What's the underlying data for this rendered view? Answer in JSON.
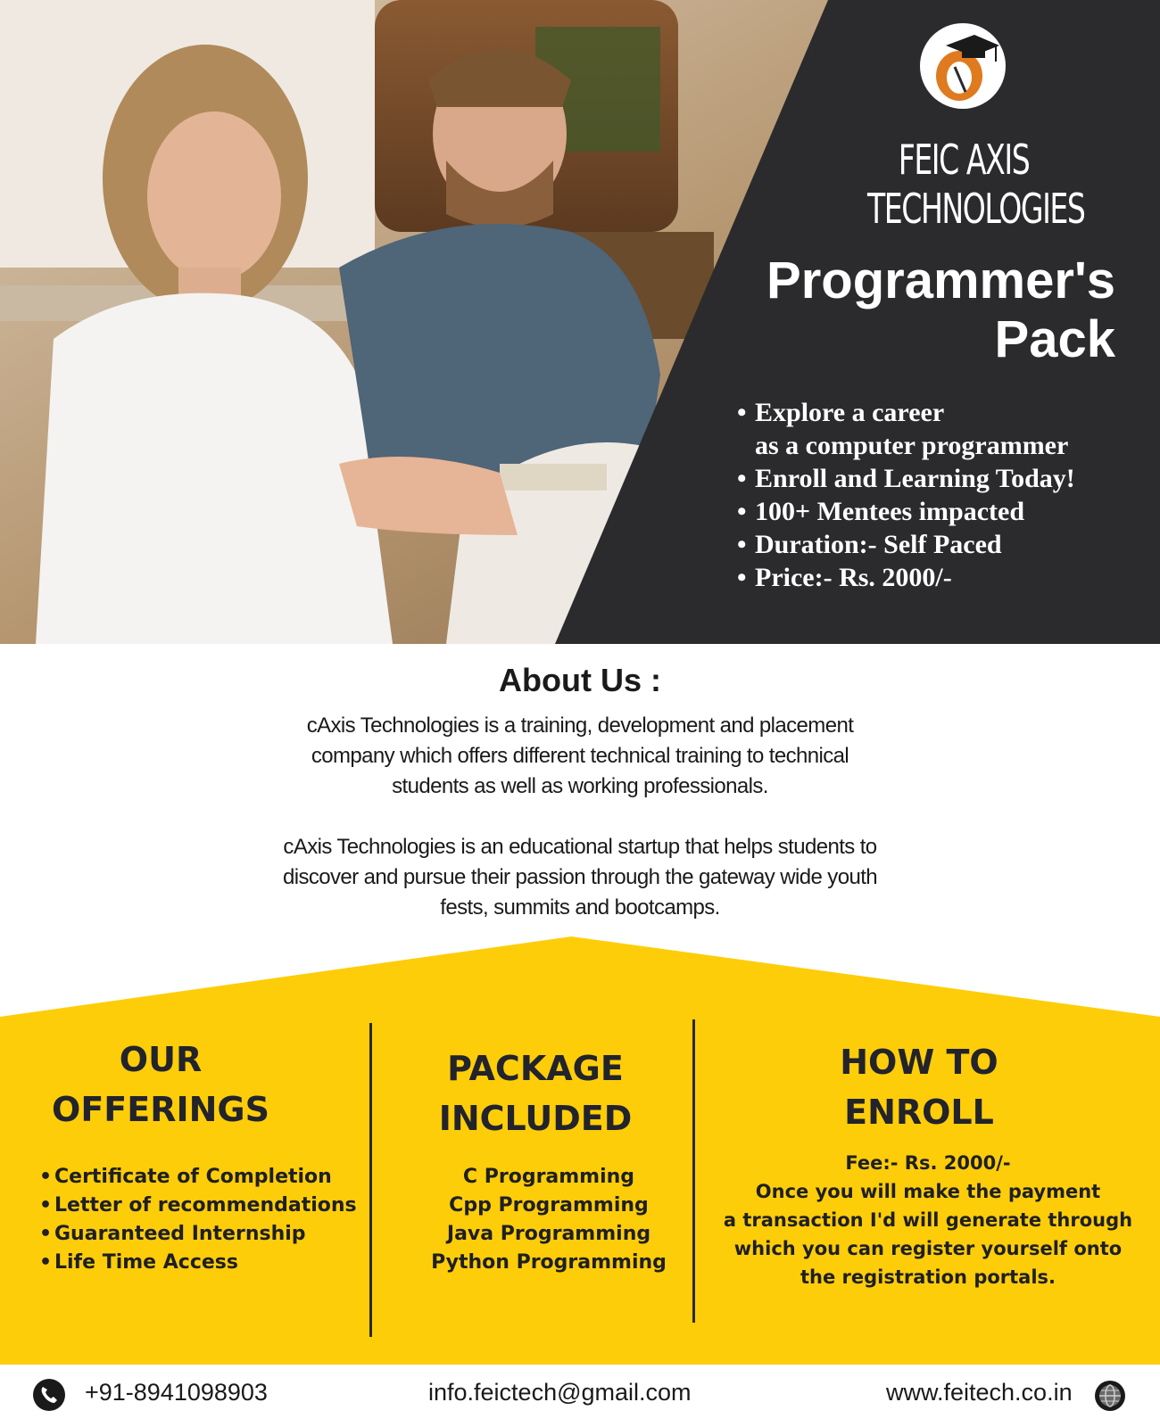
{
  "hero": {
    "brand_line1": "FEIC AXIS",
    "brand_line2": "TECHNOLOGIES",
    "title_line1": "Programmer's",
    "title_line2": "Pack",
    "bullet": "•",
    "points": [
      "Explore a career",
      "as a computer programmer",
      "Enroll and Learning Today!",
      "100+ Mentees impacted",
      "Duration:- Self Paced",
      "Price:- Rs. 2000/-"
    ]
  },
  "about": {
    "title": "About Us :",
    "para1": [
      "cAxis Technologies is a training, development and placement",
      "company which offers different technical training to technical",
      "students as well as working professionals."
    ],
    "para2": [
      "cAxis Technologies is an educational startup that helps students to",
      "discover and pursue their passion through the gateway wide youth",
      "fests, summits and bootcamps."
    ]
  },
  "offerings": {
    "title_line1": "OUR",
    "title_line2": "OFFERINGS",
    "items": [
      "Certificate of Completion",
      "Letter of recommendations",
      "Guaranteed Internship",
      "Life Time Access"
    ]
  },
  "package": {
    "title_line1": "PACKAGE",
    "title_line2": "INCLUDED",
    "items": [
      "C Programming",
      "Cpp Programming",
      "Java Programming",
      "Python Programming"
    ]
  },
  "enroll": {
    "title_line1": "HOW TO",
    "title_line2": "ENROLL",
    "lines": [
      "Fee:- Rs. 2000/-",
      "Once you will make the payment",
      "a transaction I'd will generate through",
      "which you can register yourself onto",
      "the registration portals."
    ]
  },
  "footer": {
    "phone": "+91-8941098903",
    "email": "info.feictech@gmail.com",
    "website": "www.feitech.co.in"
  },
  "icons": {
    "phone": "phone-icon",
    "globe": "globe-icon",
    "logo": "graduation-cap-logo"
  },
  "colors": {
    "dark_panel": "#2b2b2d",
    "accent_yellow": "#fdcd0a",
    "text_dark": "#22232b",
    "white": "#ffffff"
  }
}
